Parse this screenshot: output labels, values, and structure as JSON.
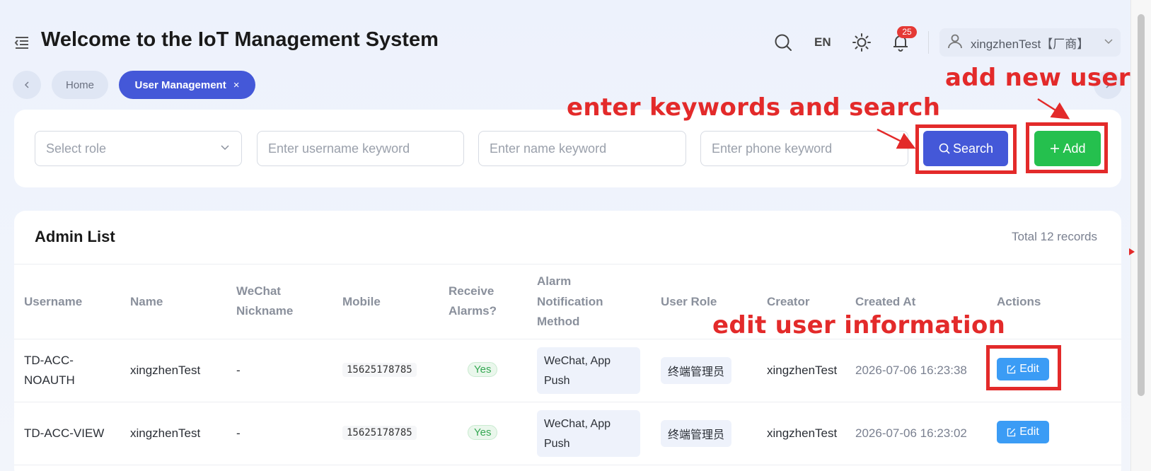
{
  "header": {
    "title": "Welcome to the IoT Management System",
    "language": "EN",
    "notification_count": "25",
    "user_name": "xingzhenTest【厂商】"
  },
  "tabs": [
    {
      "label": "Home",
      "active": false
    },
    {
      "label": "User Management",
      "active": true,
      "close": "×"
    }
  ],
  "filters": {
    "role_placeholder": "Select role",
    "username_placeholder": "Enter username keyword",
    "name_placeholder": "Enter name keyword",
    "phone_placeholder": "Enter phone keyword",
    "search_label": "Search",
    "add_label": "Add"
  },
  "annotations": {
    "search": "enter keywords and  search",
    "add": "add new user",
    "edit": "edit user  information"
  },
  "list": {
    "title": "Admin List",
    "total": "Total 12 records",
    "columns": {
      "username": "Username",
      "name": "Name",
      "wechat_line1": "WeChat",
      "wechat_line2": "Nickname",
      "mobile": "Mobile",
      "receive_line1": "Receive",
      "receive_line2": "Alarms?",
      "method_line1": "Alarm",
      "method_line2": "Notification",
      "method_line3": "Method",
      "role": "User Role",
      "creator": "Creator",
      "created_at": "Created At",
      "actions": "Actions"
    },
    "rows": [
      {
        "username_line1": "TD-ACC-",
        "username_line2": "NOAUTH",
        "name": "xingzhenTest",
        "wechat": "-",
        "mobile": "15625178785",
        "receive": "Yes",
        "method_line1": "WeChat, App",
        "method_line2": "Push",
        "role": "终端管理员",
        "creator": "xingzhenTest",
        "created_at": "2026-07-06 16:23:38",
        "action": "Edit"
      },
      {
        "username": "TD-ACC-VIEW",
        "name": "xingzhenTest",
        "wechat": "-",
        "mobile": "15625178785",
        "receive": "Yes",
        "method_line1": "WeChat, App",
        "method_line2": "Push",
        "role": "终端管理员",
        "creator": "xingzhenTest",
        "created_at": "2026-07-06 16:23:02",
        "action": "Edit"
      }
    ]
  },
  "colors": {
    "primary": "#4458d8",
    "success": "#25c04e",
    "edit": "#3b9cf5",
    "annotation": "#e32a2a"
  }
}
